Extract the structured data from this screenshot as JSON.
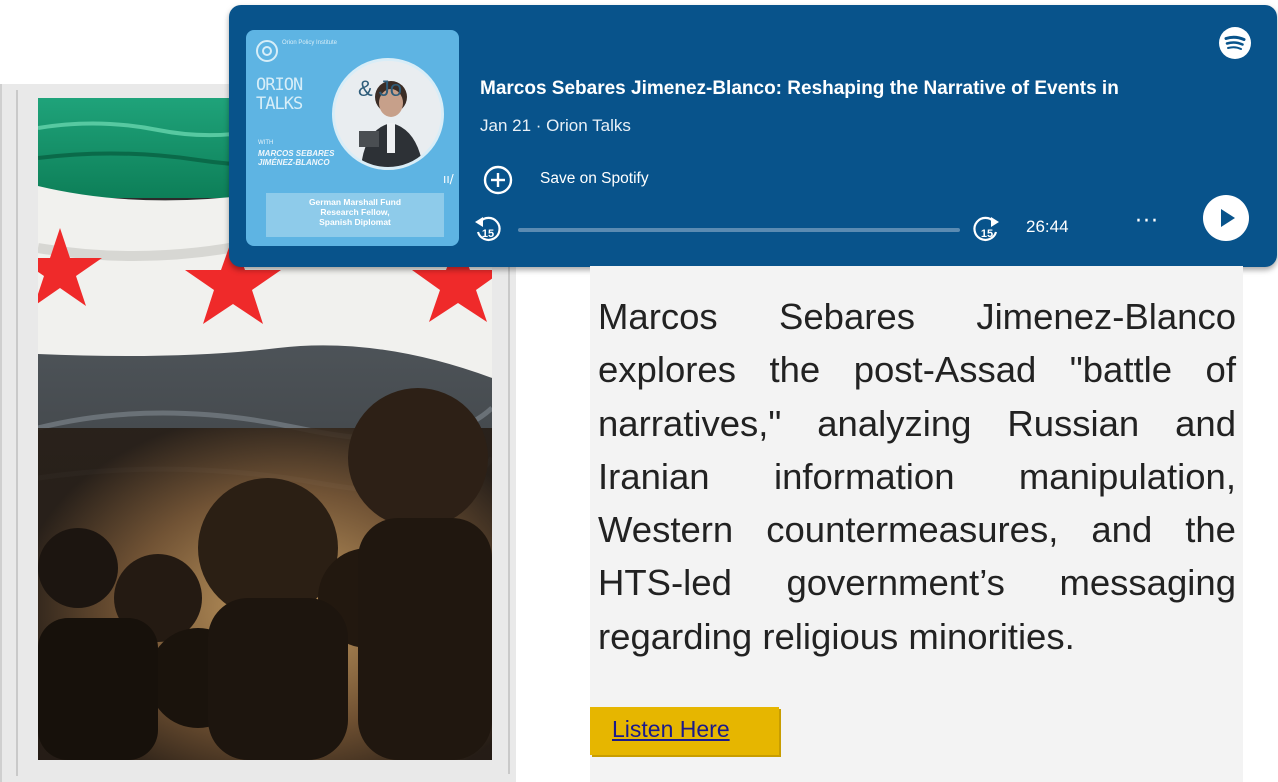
{
  "podcast": {
    "episode_title": "Marcos Sebares Jimenez-Blanco: Reshaping the Narrative of Events in",
    "meta": "Jan 21 · Orion Talks",
    "save_label": "Save on Spotify",
    "duration": "26:44",
    "more_label": "···",
    "rewind_label": "15",
    "forward_label": "15",
    "progress_fraction": 0.0,
    "accent_color": "#08538b"
  },
  "cover": {
    "logo_text": "Orion Policy Institute",
    "show_title": "ORION TALKS",
    "with_label": "WITH",
    "guest": "MARCOS SEBARES JIMÉNEZ-BLANCO",
    "ampersand": "& Jo",
    "caption": "German Marshall Fund\nResearch Fellow,\nSpanish Diplomat"
  },
  "article": {
    "description": "Marcos Sebares Jimenez-Blanco explores the post-Assad \"battle of narratives,\" analyzing Russian and Iranian information manipulation, Western countermeasures, and the HTS-led government’s messaging regarding religious minorities.",
    "listen_label": "Listen Here",
    "button_color": "#e6b600"
  }
}
